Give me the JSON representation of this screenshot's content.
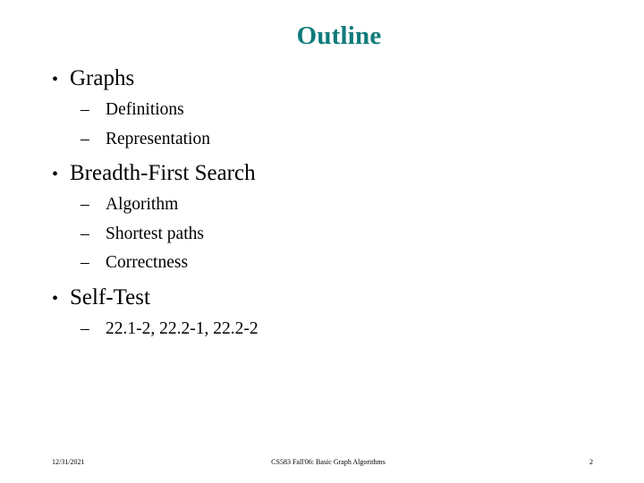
{
  "slide": {
    "title": "Outline",
    "title_color": "#0f7b7b",
    "background_color": "#ffffff",
    "bullet_marker": "•",
    "subbullet_marker": "–",
    "groups": [
      {
        "heading": "Graphs",
        "items": [
          {
            "label": "Definitions"
          },
          {
            "label": "Representation"
          }
        ]
      },
      {
        "heading": "Breadth-First Search",
        "items": [
          {
            "label": "Algorithm"
          },
          {
            "label": "Shortest paths"
          },
          {
            "label": "Correctness"
          }
        ]
      },
      {
        "heading": "Self-Test",
        "items": [
          {
            "label": "22.1-2, 22.2-1, 22.2-2"
          }
        ]
      }
    ],
    "footer": {
      "date": "12/31/2021",
      "center": "CS583 Fall'06: Basic Graph Algorithms",
      "page": "2"
    }
  }
}
